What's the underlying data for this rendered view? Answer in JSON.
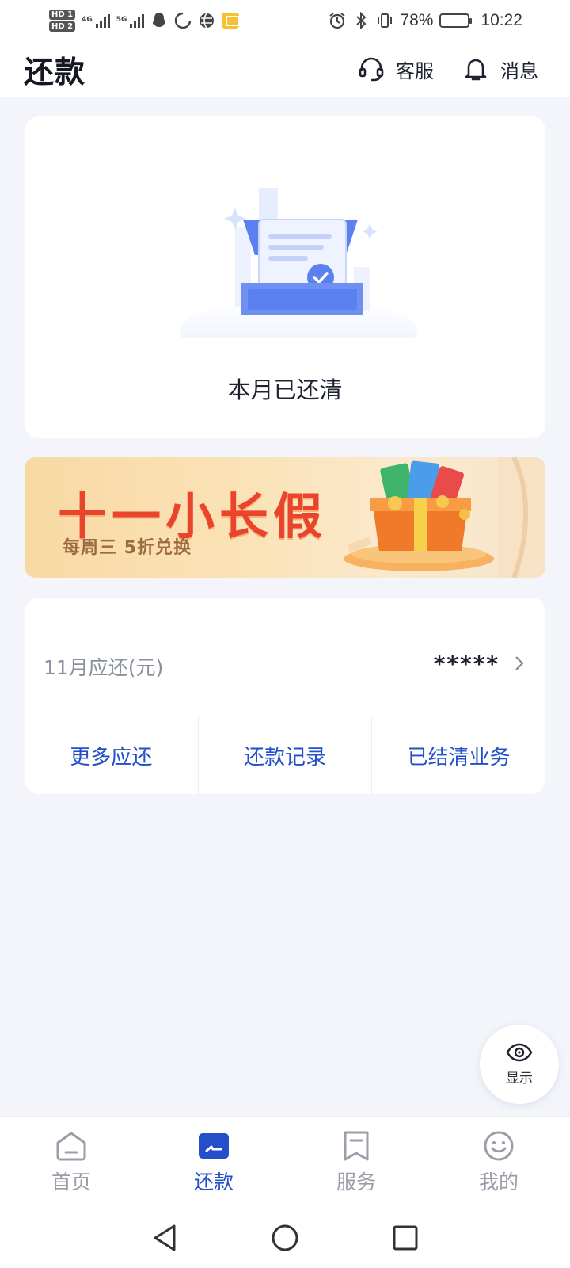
{
  "status_bar": {
    "hd1": "HD 1",
    "hd2": "HD 2",
    "net1": "4G",
    "net2": "5G",
    "battery_percent": "78%",
    "battery_level": 0.78,
    "time": "10:22"
  },
  "header": {
    "title": "还款",
    "service_label": "客服",
    "messages_label": "消息"
  },
  "status_card": {
    "message": "本月已还清"
  },
  "banner": {
    "title": "十一小长假",
    "subtitle": "每周三 5折兑换"
  },
  "repay_card": {
    "label": "11月应还(元)",
    "amount": "*****",
    "links": [
      "更多应还",
      "还款记录",
      "已结清业务"
    ]
  },
  "fab": {
    "label": "显示"
  },
  "tabbar": {
    "active_index": 1,
    "items": [
      {
        "label": "首页",
        "icon": "home-icon"
      },
      {
        "label": "还款",
        "icon": "repay-icon"
      },
      {
        "label": "服务",
        "icon": "bookmark-icon"
      },
      {
        "label": "我的",
        "icon": "smiley-icon"
      }
    ]
  },
  "colors": {
    "accent": "#2350c8",
    "background": "#f3f5fb",
    "banner_title": "#e8452c"
  }
}
